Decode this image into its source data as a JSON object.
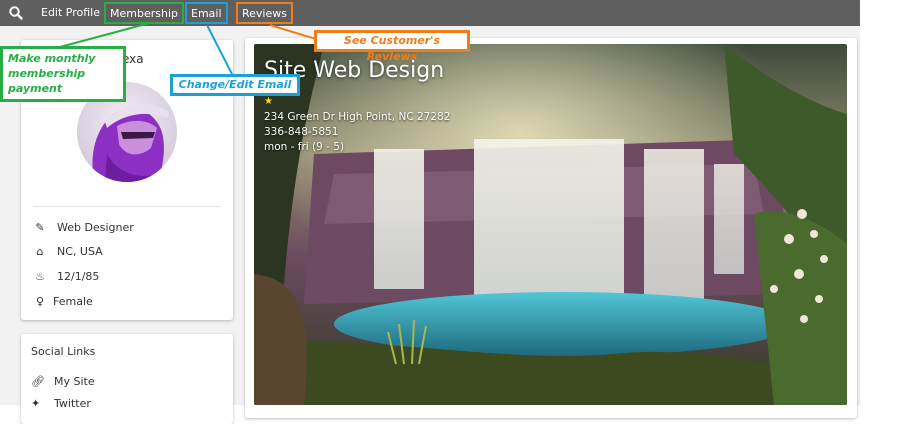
{
  "nav": {
    "items": [
      {
        "label": "Edit Profile"
      },
      {
        "label": "Membership"
      },
      {
        "label": "Email"
      },
      {
        "label": "Reviews"
      }
    ]
  },
  "profile": {
    "name_partial": "exa",
    "info": [
      {
        "icon": "pencil-icon",
        "text": "Web Designer"
      },
      {
        "icon": "home-icon",
        "text": "NC, USA"
      },
      {
        "icon": "birthday-cake-icon",
        "text": "12/1/85"
      },
      {
        "icon": "female-icon",
        "text": "Female"
      }
    ]
  },
  "social": {
    "title": "Social Links",
    "links": [
      {
        "icon": "link-icon",
        "text": "My Site"
      },
      {
        "icon": "twitter-icon",
        "text": "Twitter"
      }
    ]
  },
  "hero": {
    "title": "Site Web Design",
    "rating_star": "★",
    "address": "234 Green Dr High Point, NC 27282",
    "phone": "336-848-5851",
    "hours": "mon - fri (9 - 5)"
  },
  "callouts": {
    "membership": "Make monthly membership payment",
    "email": "Change/Edit Email",
    "reviews": "See Customer's Reviews"
  },
  "colors": {
    "navbar": "#5f5f5f",
    "callout_green": "#27ae45",
    "callout_blue": "#1aa2d8",
    "callout_orange": "#ee7d1a"
  }
}
